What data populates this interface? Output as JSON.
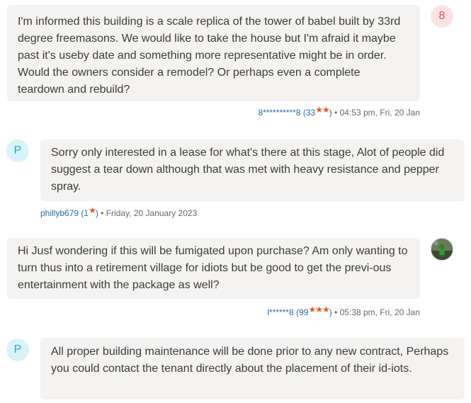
{
  "comments": [
    {
      "avatar_letter": "8",
      "text": "I'm informed this building is a scale replica of the tower of babel built by 33rd degree freemasons. We would like to take the house but I'm afraid it maybe past it's useby date and something more representative might be in order. Would the owners consider a remodel? Or perhaps even a complete teardown and rebuild?",
      "user": "8**********8",
      "rating": "33",
      "stars": "★★",
      "time": "04:53 pm, Fri, 20 Jan"
    },
    {
      "avatar_letter": "P",
      "text": "Sorry only interested in a lease for what's there at this stage, Alot of people did suggest a tear down although that was met with heavy resistance and pepper spray.",
      "user": "phillyb679",
      "rating": "1",
      "stars": "★",
      "time": "Friday, 20 January 2023"
    },
    {
      "text": "Hi Jusf wondering if this will be fumigated upon purchase? Am only wanting to turn thus into a retirement village for idiots but be good to get the previ-ous entertainment with the package as well?",
      "user": "l******8",
      "rating": "99",
      "stars": "★★★",
      "time": "05:38 pm, Fri, 20 Jan"
    },
    {
      "avatar_letter": "P",
      "text": "All proper building maintenance will be done prior to any new contract, Perhaps you could contact the tenant directly about the placement of their id-iots."
    }
  ],
  "colors": {
    "bubble_bg": "#f4f3f1",
    "username": "#2b6aa8",
    "star": "#e4571b",
    "avatar_8_bg": "#fbe3e4",
    "avatar_p_bg": "#d9f3f8"
  }
}
